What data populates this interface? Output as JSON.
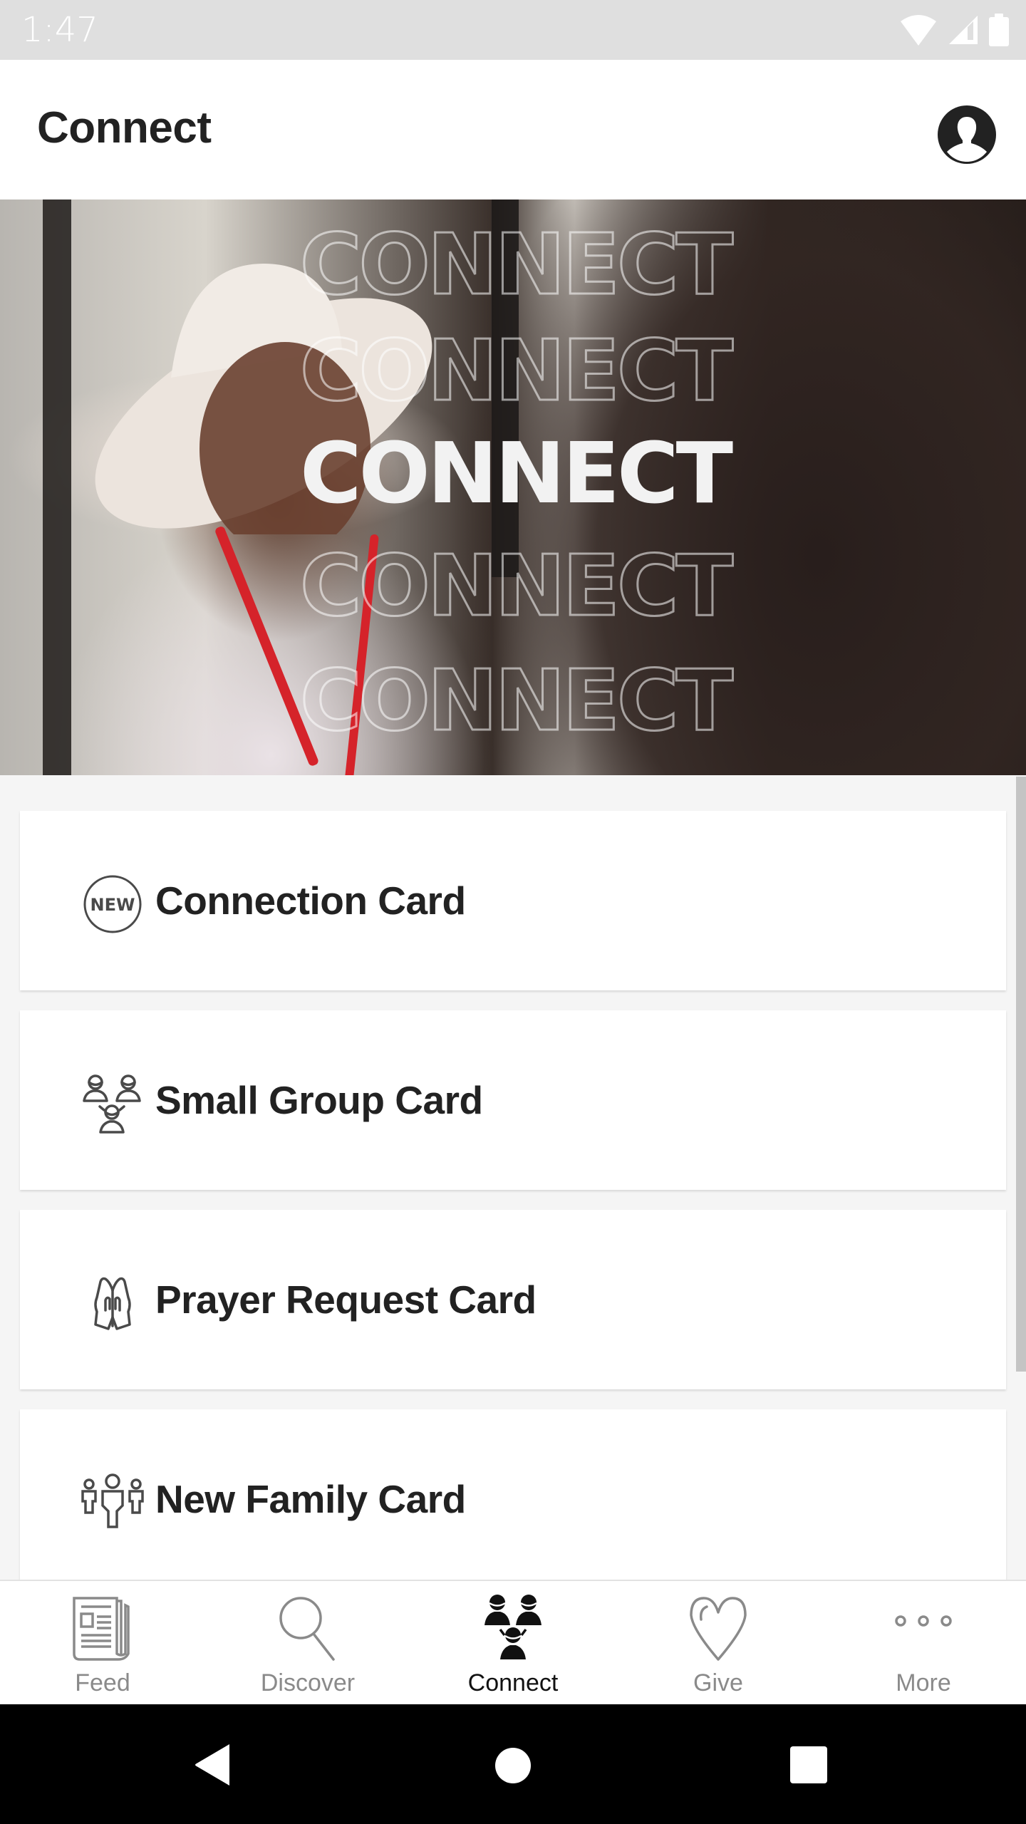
{
  "status_bar": {
    "time": "1:47",
    "icons": [
      "wifi-icon",
      "cell-signal-icon",
      "battery-icon"
    ]
  },
  "header": {
    "title": "Connect",
    "profile_icon": "account-circle-icon"
  },
  "hero": {
    "words": [
      "CONNECT",
      "CONNECT",
      "CONNECT",
      "CONNECT",
      "CONNECT"
    ],
    "highlighted_index": 2
  },
  "cards": [
    {
      "label": "Connection Card",
      "icon": "new-badge-icon",
      "icon_text": "NEW"
    },
    {
      "label": "Small Group Card",
      "icon": "small-group-icon"
    },
    {
      "label": "Prayer Request Card",
      "icon": "praying-hands-icon"
    },
    {
      "label": "New Family Card",
      "icon": "family-icon"
    }
  ],
  "bottom_nav": {
    "active": "Connect",
    "items": [
      {
        "label": "Feed",
        "icon": "newspaper-icon"
      },
      {
        "label": "Discover",
        "icon": "search-icon"
      },
      {
        "label": "Connect",
        "icon": "group-icon"
      },
      {
        "label": "Give",
        "icon": "heart-icon"
      },
      {
        "label": "More",
        "icon": "more-dots-icon"
      }
    ]
  },
  "colors": {
    "status_bar": "#dfdfdf",
    "text_primary": "#222222",
    "nav_inactive": "#8a8a8a",
    "nav_active": "#111111",
    "list_background": "#f5f5f5",
    "lanyard_red": "#d5232a"
  }
}
